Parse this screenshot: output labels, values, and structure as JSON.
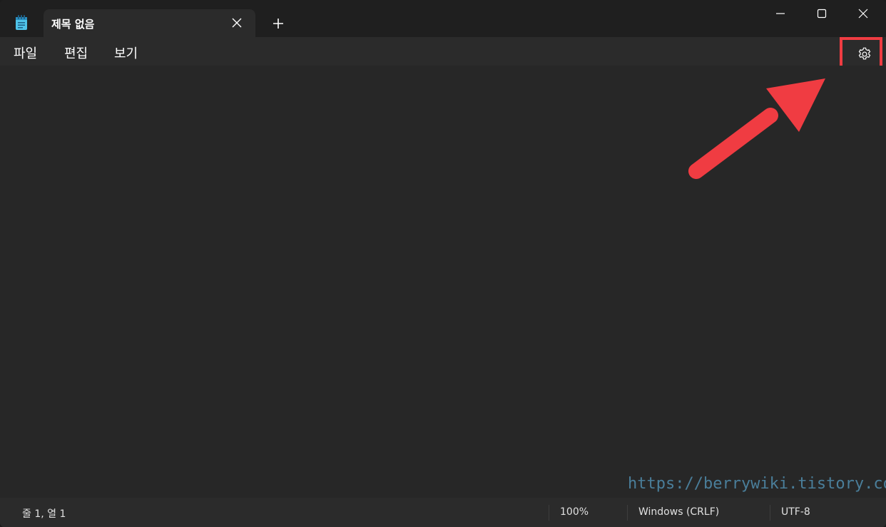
{
  "window": {
    "tab_title": "제목 없음"
  },
  "menu": {
    "file": "파일",
    "edit": "편집",
    "view": "보기"
  },
  "icons": {
    "app": "notepad-icon",
    "tab_close": "close-icon",
    "new_tab": "plus-icon",
    "minimize": "minimize-icon",
    "maximize": "maximize-icon",
    "close": "close-icon",
    "settings": "gear-icon",
    "annotation": "red-arrow-icon"
  },
  "editor": {
    "content": ""
  },
  "watermark": "https://berrywiki.tistory.com",
  "status": {
    "position": "줄 1, 열 1",
    "zoom": "100%",
    "line_ending": "Windows (CRLF)",
    "encoding": "UTF-8"
  },
  "colors": {
    "highlight": "#f03c42",
    "watermark": "#4a7e9a",
    "background": "#272727"
  }
}
